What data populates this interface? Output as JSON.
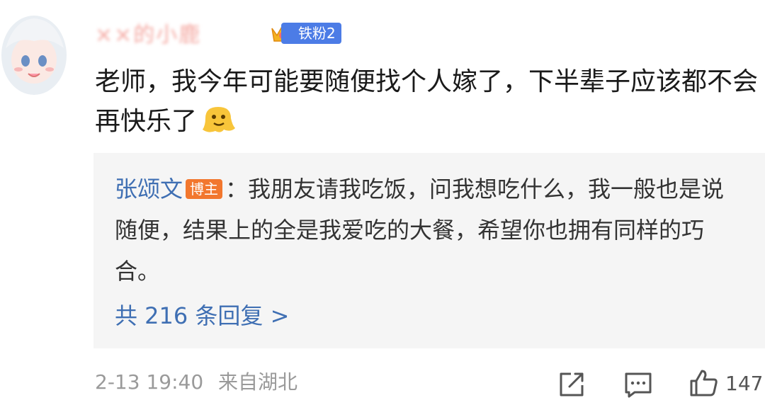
{
  "comment": {
    "username": "××的小鹿",
    "fan_badge": "铁粉2",
    "text": "老师，我今年可能要随便找个人嫁了，下半辈子应该都不会再快乐了",
    "timestamp": "2-13 19:40",
    "location": "来自湖北",
    "like_count": "147"
  },
  "reply": {
    "author": "张颂文",
    "badge": "博主",
    "separator": "：",
    "text": "我朋友请我吃饭，问我想吃什么，我一般也是说随便，结果上的全是我爱吃的大餐，希望你也拥有同样的巧合。",
    "count_label": "共 216 条回复 >"
  },
  "colors": {
    "link_blue": "#3f6fb3",
    "badge_blue": "#4c7ce6",
    "host_orange": "#f2772e",
    "reply_bg": "#f5f5f5"
  },
  "icons": [
    "avatar",
    "crown-icon",
    "melting-face-emoji",
    "share-icon",
    "comment-icon",
    "like-icon"
  ]
}
